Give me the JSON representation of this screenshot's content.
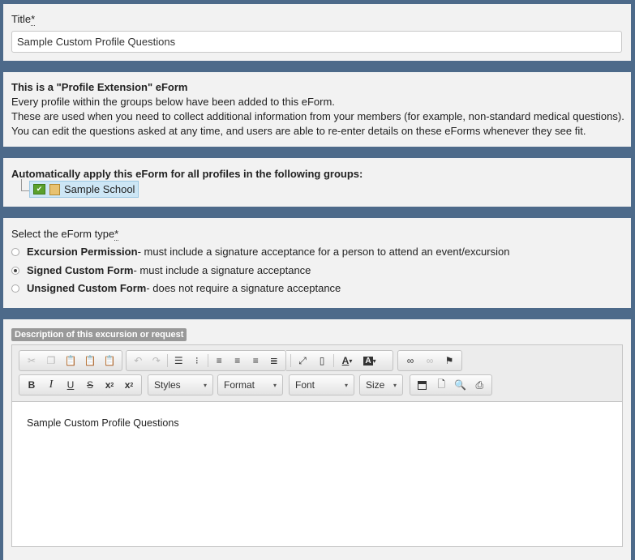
{
  "title_field": {
    "label": "Title",
    "required_mark": "*",
    "value": "Sample Custom Profile Questions"
  },
  "info": {
    "heading": "This is a \"Profile Extension\" eForm",
    "lines": [
      "Every profile within the groups below have been added to this eForm.",
      "These are used when you need to collect additional information from your members (for example, non-standard medical questions).",
      "You can edit the questions asked at any time, and users are able to re-enter details on these eForms whenever they see fit."
    ]
  },
  "groups": {
    "heading": "Automatically apply this eForm for all profiles in the following groups:",
    "items": [
      {
        "label": "Sample School",
        "checked": true
      }
    ]
  },
  "eform_type": {
    "label": "Select the eForm type",
    "required_mark": "*",
    "options": [
      {
        "name": "Excursion Permission",
        "desc": " - must include a signature acceptance for a person to attend an event/excursion",
        "selected": false
      },
      {
        "name": "Signed Custom Form",
        "desc": " - must include a signature acceptance",
        "selected": true
      },
      {
        "name": "Unsigned Custom Form",
        "desc": " - does not require a signature acceptance",
        "selected": false
      }
    ]
  },
  "description": {
    "badge": "Description of this excursion or request",
    "combos": {
      "styles": "Styles",
      "format": "Format",
      "font": "Font",
      "size": "Size"
    },
    "content": "Sample Custom Profile Questions",
    "toolbar_icons": [
      "cut-icon",
      "copy-icon",
      "paste-icon",
      "paste-text-icon",
      "paste-word-icon",
      "undo-icon",
      "redo-icon",
      "numbered-list-icon",
      "bulleted-list-icon",
      "align-left-icon",
      "align-center-icon",
      "align-right-icon",
      "justify-icon",
      "maximize-icon",
      "show-blocks-icon",
      "text-color-icon",
      "background-color-icon",
      "link-icon",
      "unlink-icon",
      "anchor-icon",
      "bold-icon",
      "italic-icon",
      "underline-icon",
      "strike-icon",
      "subscript-icon",
      "superscript-icon",
      "save-icon",
      "new-page-icon",
      "preview-icon",
      "print-icon"
    ]
  },
  "colors": {
    "page_bg": "#4d6a8a",
    "panel_bg": "#f2f2f2",
    "tree_highlight": "#cde6f5"
  }
}
